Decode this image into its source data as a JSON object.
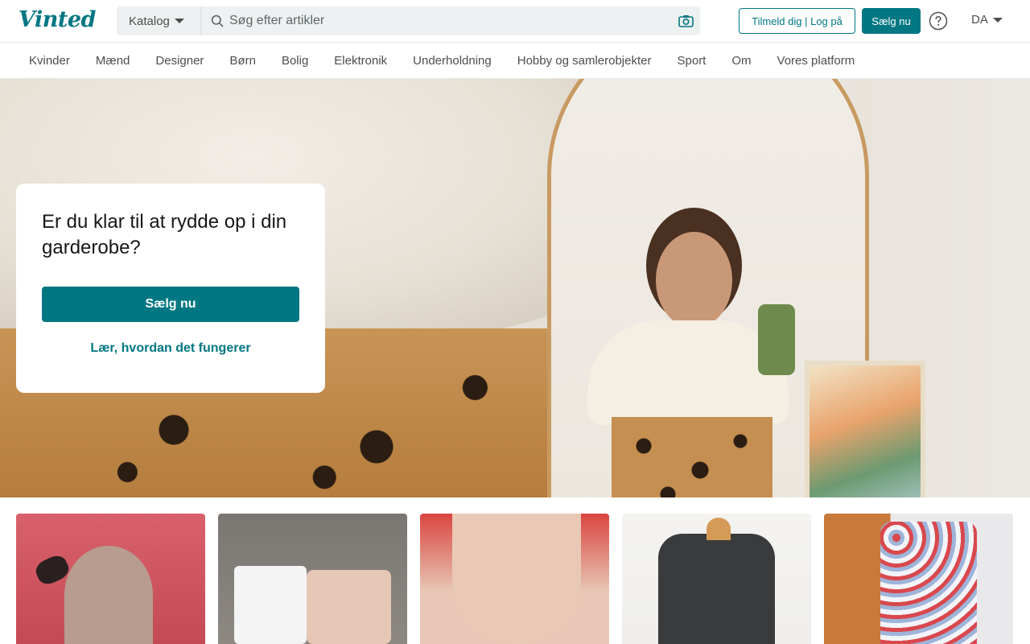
{
  "header": {
    "logo": "Vinted",
    "katalog_label": "Katalog",
    "search_placeholder": "Søg efter artikler",
    "signup_label": "Tilmeld dig | Log på",
    "sell_label": "Sælg nu",
    "language": "DA",
    "icons": {
      "search": "search-icon",
      "camera": "camera-icon",
      "help": "help-icon",
      "caret": "chevron-down-icon"
    }
  },
  "nav": {
    "items": [
      {
        "label": "Kvinder"
      },
      {
        "label": "Mænd"
      },
      {
        "label": "Designer"
      },
      {
        "label": "Børn"
      },
      {
        "label": "Bolig"
      },
      {
        "label": "Elektronik"
      },
      {
        "label": "Underholdning"
      },
      {
        "label": "Hobby og samlerobjekter"
      },
      {
        "label": "Sport"
      },
      {
        "label": "Om"
      },
      {
        "label": "Vores platform"
      }
    ]
  },
  "hero": {
    "title": "Er du klar til at rydde op i din garderobe?",
    "sell_button": "Sælg nu",
    "learn_link": "Lær, hvordan det fungerer"
  },
  "colors": {
    "brand": "#007782",
    "text": "#171717",
    "muted": "#4d4d4d"
  },
  "items": [
    {
      "image": "doll-photo"
    },
    {
      "image": "kids-clothes-photo"
    },
    {
      "image": "red-top-necklace-photo"
    },
    {
      "image": "black-hoodie-photo"
    },
    {
      "image": "patterned-shirt-photo"
    }
  ]
}
